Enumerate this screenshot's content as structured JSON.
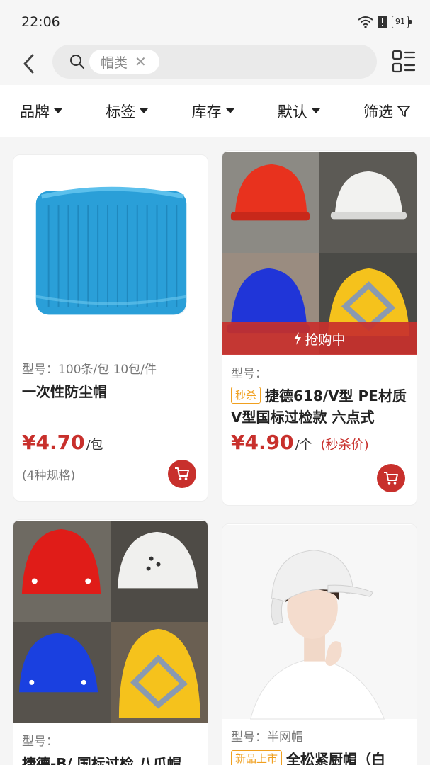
{
  "status_bar": {
    "time": "22:06",
    "battery": "91"
  },
  "search": {
    "chip_text": "帽类",
    "clear_icon": "✕"
  },
  "filters": [
    {
      "label": "品牌"
    },
    {
      "label": "标签"
    },
    {
      "label": "库存"
    },
    {
      "label": "默认"
    },
    {
      "label": "筛选"
    }
  ],
  "products": [
    {
      "model": "型号：100条/包 10包/件",
      "title": "一次性防尘帽",
      "price": "¥4.70",
      "unit": "/包",
      "specs": "(4种规格)"
    },
    {
      "flash_label": "抢购中",
      "model": "型号：",
      "tag": "秒杀",
      "title": "捷德618/V型 PE材质 V型国标过检款 六点式",
      "price": "¥4.90",
      "unit": "/个",
      "seckill": "(秒杀价)"
    },
    {
      "model": "型号：",
      "title": "捷德-B/ 国标过检 八爪帽"
    },
    {
      "model": "型号：半网帽",
      "tag": "新品上市",
      "title": "全松紧厨帽（白"
    }
  ],
  "colors": {
    "accent": "#c8302c",
    "tag": "#f0a020",
    "cap_blue": "#2a9fd8"
  }
}
